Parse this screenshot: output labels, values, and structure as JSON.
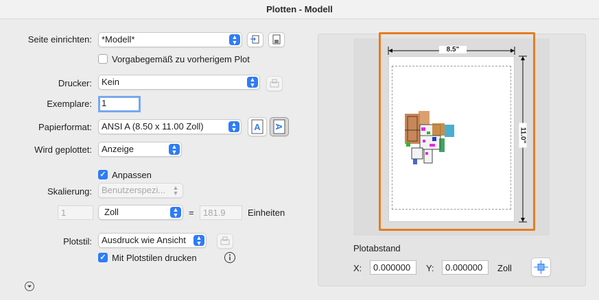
{
  "window": {
    "title": "Plotten - Modell"
  },
  "page_setup": {
    "label": "Seite einrichten:",
    "value": "*Modell*"
  },
  "use_previous": {
    "label": "Vorgabegemäß zu vorherigem Plot",
    "checked": false
  },
  "printer": {
    "label": "Drucker:",
    "value": "Kein"
  },
  "copies": {
    "label": "Exemplare:",
    "value": "1"
  },
  "paper_format": {
    "label": "Papierformat:",
    "value": "ANSI A (8.50 x 11.00 Zoll)"
  },
  "plot_area": {
    "label": "Wird geplottet:",
    "value": "Anzeige"
  },
  "fit": {
    "label": "Anpassen",
    "checked": true
  },
  "scaling": {
    "label": "Skalierung:",
    "value": "Benutzerspezi...",
    "left_value": "1",
    "unit": "Zoll",
    "equals": "=",
    "right_value": "181.9",
    "units_label": "Einheiten"
  },
  "plot_style": {
    "label": "Plotstil:",
    "value": "Ausdruck wie Ansicht"
  },
  "plot_with_styles": {
    "label": "Mit Plotstilen drucken",
    "checked": true
  },
  "preview": {
    "width_label": "8.5\"",
    "height_label": "11.0\""
  },
  "offset": {
    "title": "Plotabstand",
    "x_label": "X:",
    "x_value": "0.000000",
    "y_label": "Y:",
    "y_value": "0.000000",
    "unit": "Zoll"
  },
  "colors": {
    "accent": "#2f7cf6",
    "highlight": "#e57c1f"
  }
}
